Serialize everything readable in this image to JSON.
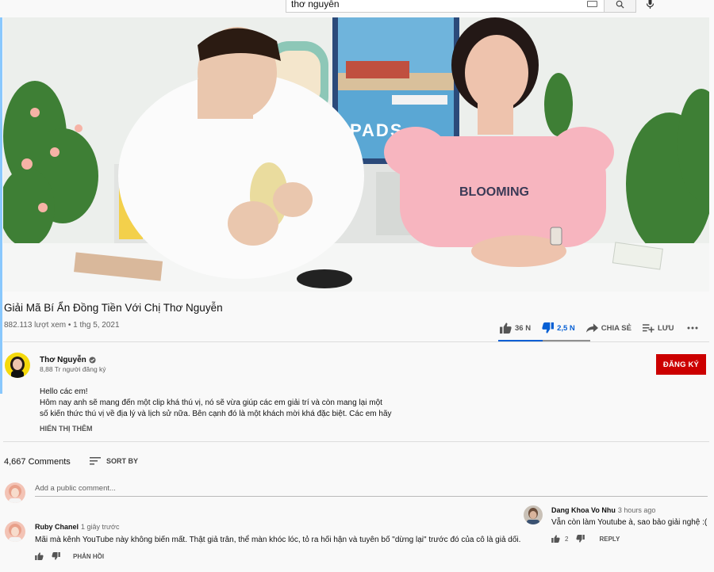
{
  "search": {
    "value": "thơ nguyễn"
  },
  "video": {
    "title": "Giải Mã Bí Ẩn Đồng Tiền Với Chị Thơ Nguyễn",
    "views": "882.113 lượt xem",
    "date": "1 thg 5, 2021",
    "sign_text": "PADS",
    "shirt_text": "BLOOMING",
    "like_ratio": 0.48
  },
  "actions": {
    "likes": "36 N",
    "dislikes": "2,5 N",
    "share": "CHIA SẺ",
    "save": "LƯU"
  },
  "channel": {
    "name": "Thơ Nguyễn",
    "subscribers": "8,88 Tr người đăng ký",
    "subscribe_label": "ĐĂNG KÝ"
  },
  "description": {
    "lines": [
      "Hello các em!",
      "Hôm nay anh sẽ mang đến một clip khá thú vị, nó sẽ vừa giúp các em giải trí và còn mang lại một",
      "số kiến thức thú vị về địa lý và lịch sử nữa. Bên cạnh đó là một khách mời khá đặc biệt. Các em hãy"
    ],
    "show_more": "HIỂN THỊ THÊM"
  },
  "comments": {
    "count": "4,667 Comments",
    "sort_by": "SORT BY",
    "placeholder": "Add a public comment...",
    "items": [
      {
        "author": "Ruby Chanel",
        "time": "1 giây trước",
        "text": "Mãi mà kênh YouTube này không biến mất. Thật giả trân, thể màn khóc lóc, tỏ ra hối hận và tuyên bố \"dừng lại\" trước đó của cô là giả dối.",
        "reply": "PHẢN HỒI"
      },
      {
        "author": "Dang Khoa Vo Nhu",
        "time": "3 hours ago",
        "text": "Vẫn còn làm Youtube à, sao bảo giải nghệ :(",
        "likes": "2",
        "reply": "REPLY"
      }
    ]
  },
  "colors": {
    "subscribe": "#cc0000",
    "like_active": "#065fd4",
    "verified": "#606060"
  }
}
